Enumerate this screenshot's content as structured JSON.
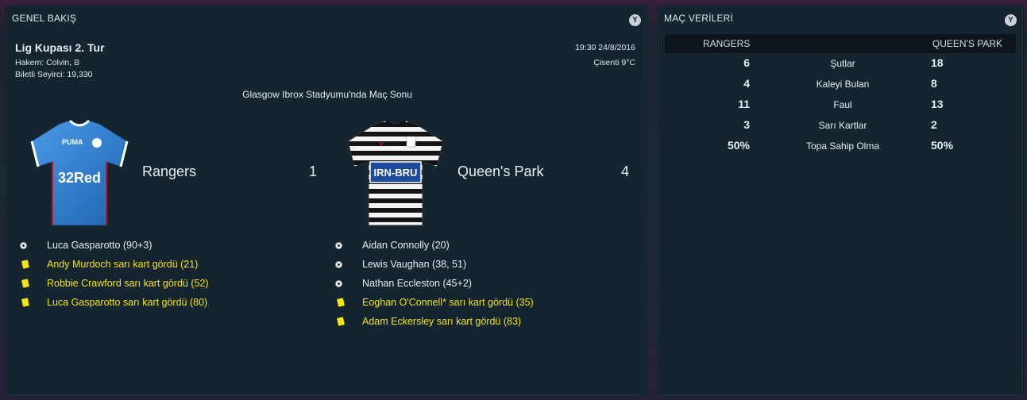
{
  "overview": {
    "title": "GENEL BAKIŞ",
    "filter_icon": "filter-icon",
    "competition": "Lig Kupası 2. Tur",
    "referee": "Hakem: Colvin, B",
    "attendance": "Biletli Seyirci: 19,330",
    "datetime": "19:30 24/8/2016",
    "weather": "Çisenti 9°C",
    "venue": "Glasgow Ibrox Stadyumu'nda Maç Sonu",
    "home": {
      "name": "Rangers",
      "score": "1",
      "kit_sponsor": "32Red",
      "kit_color": "#2f7fd0",
      "events": [
        {
          "type": "goal",
          "text": "Luca Gasparotto (90+3)"
        },
        {
          "type": "card",
          "text": "Andy Murdoch sarı kart gördü (21)"
        },
        {
          "type": "card",
          "text": "Robbie Crawford sarı kart gördü (52)"
        },
        {
          "type": "card",
          "text": "Luca Gasparotto sarı kart gördü (80)"
        }
      ]
    },
    "away": {
      "name": "Queen's Park",
      "score": "4",
      "kit_sponsor": "IRN-BRU",
      "events": [
        {
          "type": "goal",
          "text": "Aidan Connolly (20)"
        },
        {
          "type": "goal",
          "text": "Lewis Vaughan (38, 51)"
        },
        {
          "type": "goal",
          "text": "Nathan Eccleston (45+2)"
        },
        {
          "type": "card",
          "text": "Eoghan O'Connell* sarı kart gördü (35)"
        },
        {
          "type": "card",
          "text": "Adam Eckersley sarı kart gördü (83)"
        }
      ]
    }
  },
  "stats": {
    "title": "MAÇ VERİLERİ",
    "home_header": "RANGERS",
    "away_header": "QUEEN'S PARK",
    "rows": [
      {
        "label": "Şutlar",
        "home": "6",
        "away": "18"
      },
      {
        "label": "Kaleyi Bulan",
        "home": "4",
        "away": "8"
      },
      {
        "label": "Faul",
        "home": "11",
        "away": "13"
      },
      {
        "label": "Sarı Kartlar",
        "home": "3",
        "away": "2"
      },
      {
        "label": "Topa Sahip Olma",
        "home": "50%",
        "away": "50%"
      }
    ]
  },
  "colors": {
    "card_text": "#f2e20f",
    "panel_bg": "#152530"
  }
}
